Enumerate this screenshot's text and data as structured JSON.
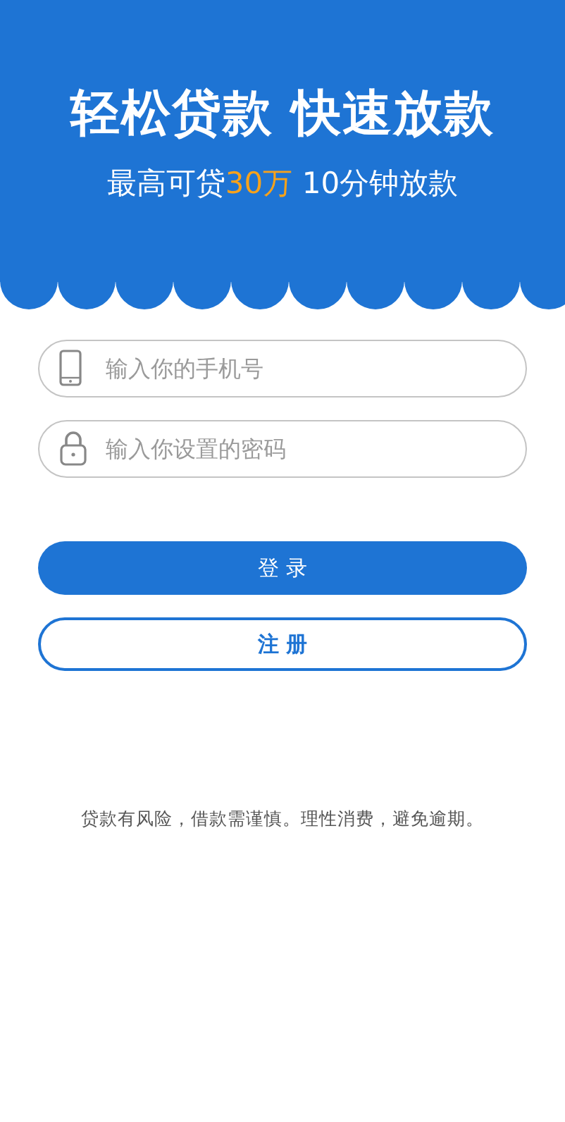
{
  "header": {
    "title": "轻松贷款 快速放款",
    "subtitle": [
      {
        "text": "最高可贷",
        "highlight": false
      },
      {
        "text": "30万",
        "highlight": true
      },
      {
        "text": " 10分钟放款",
        "highlight": false
      }
    ]
  },
  "fields": [
    {
      "kind": "phone",
      "placeholder": "输入你的手机号"
    },
    {
      "kind": "password",
      "placeholder": "输入你设置的密码"
    }
  ],
  "buttons": [
    {
      "kind": "primary",
      "label": "登 录"
    },
    {
      "kind": "outline",
      "label": "注 册"
    }
  ],
  "disclaimer": "贷款有风险，借款需谨慎。理性消费，避免逾期。"
}
